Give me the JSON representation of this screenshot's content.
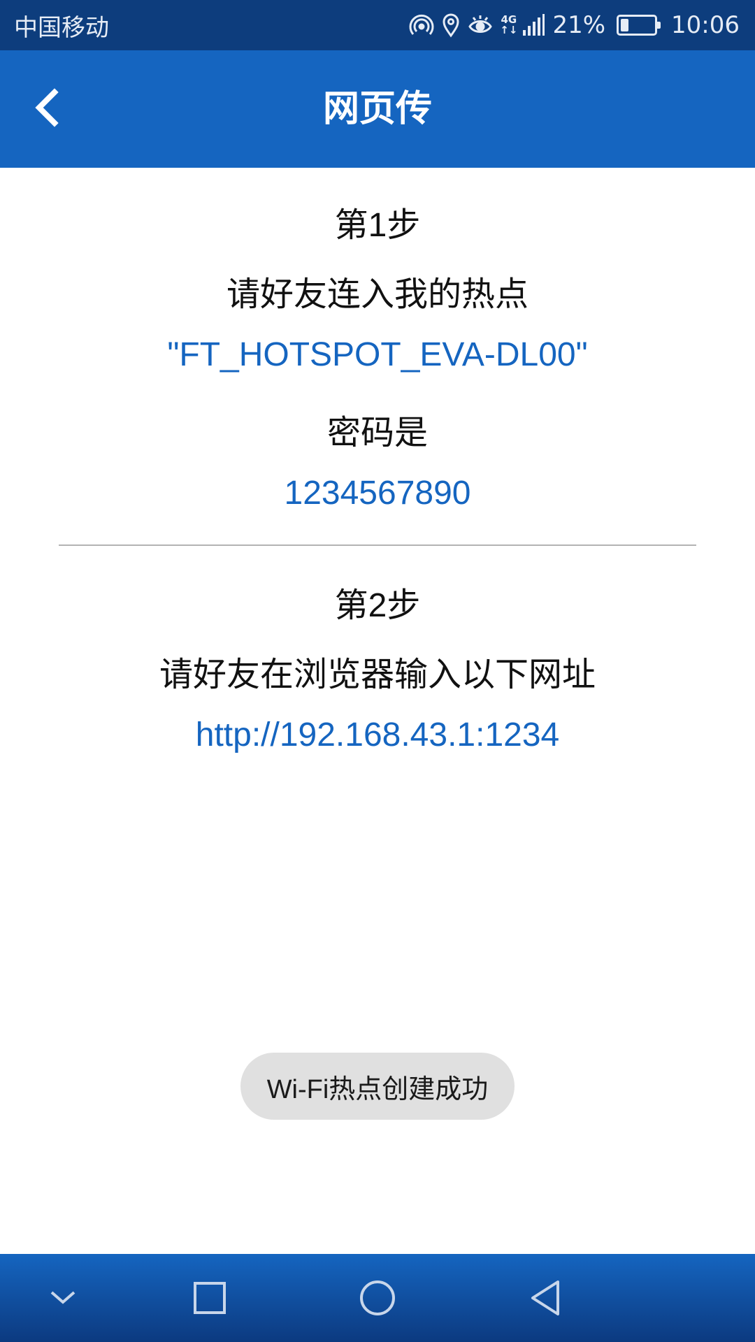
{
  "status_bar": {
    "carrier": "中国移动",
    "network_type_top": "4G",
    "network_type_bottom": "↑↓",
    "battery_percent": "21%",
    "battery_level": 0.21,
    "time": "10:06"
  },
  "header": {
    "title": "网页传"
  },
  "step1": {
    "heading": "第1步",
    "instruction": "请好友连入我的热点",
    "hotspot_name": "\"FT_HOTSPOT_EVA-DL00\"",
    "password_label": "密码是",
    "password": "1234567890"
  },
  "step2": {
    "heading": "第2步",
    "instruction": "请好友在浏览器输入以下网址",
    "url": "http://192.168.43.1:1234"
  },
  "toast": {
    "message": "Wi-Fi热点创建成功"
  },
  "colors": {
    "accent": "#1565c0",
    "status_bar": "#0d3d7d",
    "toast_bg": "#e0e0e0"
  }
}
